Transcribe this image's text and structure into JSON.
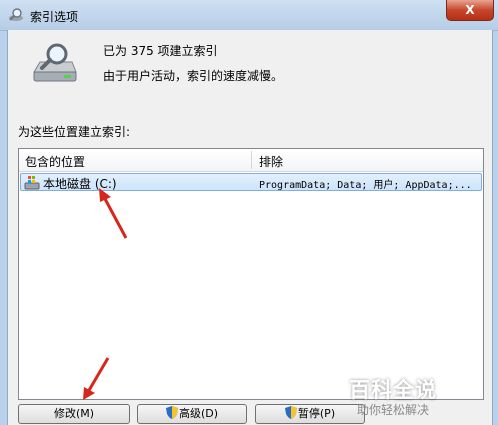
{
  "window": {
    "title": "索引选项",
    "close_symbol": "X"
  },
  "status": {
    "indexed_count": "已为 375 项建立索引",
    "slow_note": "由于用户活动，索引的速度减慢。"
  },
  "section_label": "为这些位置建立索引:",
  "table": {
    "headers": {
      "location": "包含的位置",
      "exclude": "排除"
    },
    "rows": [
      {
        "location": "本地磁盘 (C:)",
        "exclude": "ProgramData; Data; 用户; AppData;..."
      }
    ]
  },
  "buttons": {
    "modify": "修改(M)",
    "advanced": "高级(D)",
    "pause": "暂停(P)"
  },
  "watermark": {
    "main": "百科全说",
    "sub": "助你轻松解决"
  },
  "colors": {
    "annotation_arrow": "#d9261c",
    "selection": "#cde4fb"
  }
}
